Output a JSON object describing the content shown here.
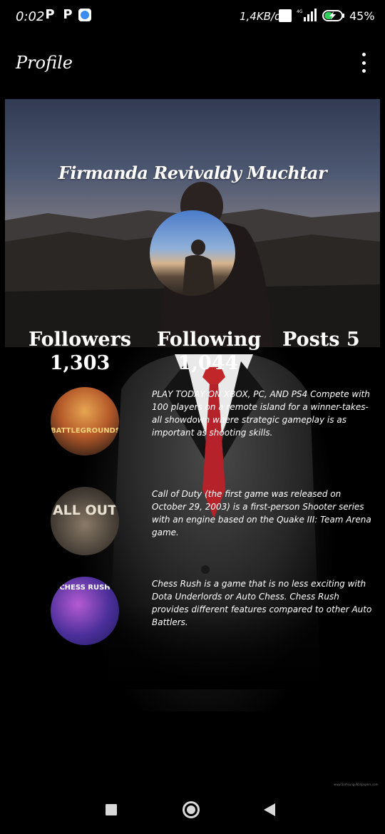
{
  "status_bar": {
    "time": "0:02",
    "app_icons": [
      "P",
      "P"
    ],
    "network_speed": "1,4KB/d",
    "volte": "VoLTE",
    "network_type": "4G",
    "battery_percent": "45%"
  },
  "app_bar": {
    "title": "Profile",
    "menu_icon": "more-vert-icon"
  },
  "profile": {
    "name": "Firmanda Revivaldy Muchtar",
    "stats": {
      "followers_label": "Followers",
      "followers_value": "1,303",
      "following_label": "Following",
      "following_value": "1,044",
      "posts_label": "Posts 5"
    }
  },
  "posts": [
    {
      "thumb_label": "BATTLEGROUNDS",
      "text": "PLAY TODAY ON XBOX, PC, AND PS4 Compete with 100 players on a remote island for a winner-takes-all showdown where strategic gameplay is as important as shooting skills."
    },
    {
      "thumb_label": "ALL OUT",
      "text": "Call of Duty (the first game was released on October 29, 2003) is a first-person Shooter series with an engine based on the Quake III: Team Arena game."
    },
    {
      "thumb_label": "CHESS RUSH",
      "text": "Chess Rush is a game that is no less exciting with Dota Underlords or Auto Chess. Chess Rush provides different features compared to other Auto Battlers."
    }
  ],
  "watermark": "www.Samsung-Wallpapers.com",
  "colors": {
    "background": "#000000",
    "text": "#ffffff",
    "tie": "#c0262a"
  }
}
